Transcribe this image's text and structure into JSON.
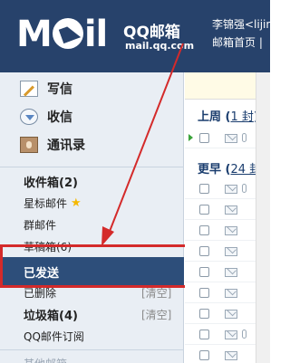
{
  "header": {
    "logo_text": "Moil",
    "brand": "QQ邮箱",
    "url": "mail.qq.com",
    "user_name": "李锦强<lijin",
    "link_home": "邮箱首页 |"
  },
  "sidebar": {
    "main": [
      {
        "label": "写信",
        "icon": "compose-icon"
      },
      {
        "label": "收信",
        "icon": "receive-icon"
      },
      {
        "label": "通讯录",
        "icon": "contacts-icon"
      }
    ],
    "folders": {
      "inbox": "收件箱(2)",
      "starred": "星标邮件",
      "group": "群邮件",
      "drafts": "草稿箱(6)",
      "sent": "已发送",
      "deleted": "已删除",
      "deleted_clear": "[清空]",
      "spam": "垃圾箱(4)",
      "spam_clear": "[清空]",
      "subscribe": "QQ邮件订阅",
      "other": "其他邮箱"
    }
  },
  "content": {
    "group1": {
      "label": "上周",
      "count": "1 封"
    },
    "group2": {
      "label": "更早",
      "count": "24 封"
    }
  },
  "colors": {
    "header": "#27426b",
    "highlight": "#d42a2a",
    "selected": "#2d4e7a"
  }
}
